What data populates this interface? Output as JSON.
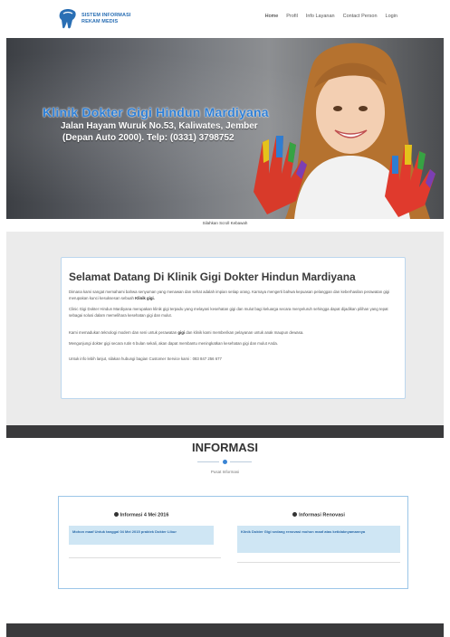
{
  "header": {
    "logo_line1": "SISTEM INFORMASI",
    "logo_line2": "REKAM MEDIS",
    "nav": [
      {
        "label": "Home"
      },
      {
        "label": "Profil"
      },
      {
        "label": "Info Layanan"
      },
      {
        "label": "Contact Person"
      },
      {
        "label": "Login"
      }
    ]
  },
  "hero": {
    "title": "Klinik Dokter Gigi Hindun Mardiyana",
    "address_line1": "Jalan Hayam Wuruk No.53, Kaliwates, Jember",
    "address_line2": "(Depan Auto 2000). Telp: (0331) 3798752",
    "scroll_hint": "Silahkan Scroll Kebawah"
  },
  "welcome": {
    "heading": "Selamat Datang Di Klinik Gigi Dokter Hindun Mardiyana",
    "p1": "Dimana kami sangat memahami bahwa senyuman yang menawan dan sehat adalah impian setiap orang. Karnaya mengerti bahwa kepuasan pelanggan dan keberhasilan perawatan gigi merupakan kunci kesuksesan sebuah",
    "p1_bold": "Klinik gigi.",
    "p2": "Clinic Gigi Dokter Hindun Mardiyana merupakan klinik gigi terpadu yang melayani kesehatan gigi dan mulut bagi keluarga secara menyeluruh sehingga dapat dijadikan pilihan yang tepat sebagai solusi dalam memelihara kesehatan gigi dan mulut.",
    "p3_start": "Kami memadukan teknologi modern dan seni untuk perawatan",
    "p3_bold": "gigi",
    "p3_end": "dan klinik kami memberikan pelayanan untuk anak maupun dewasa.",
    "p4": "Mengunjungi dokter gigi secara rutin 6 bulan sekali, akan dapat membantu meningkatkan kesehatan gigi dan mulut Anda.",
    "p5": "Untuk info lebih lanjut, silakan hubungi bagian Customer Service kami : 083 847 256 677"
  },
  "informasi": {
    "title": "INFORMASI",
    "subtitle": "Pusat Informasi",
    "left_heading": "Informasi 4 Mei 2016",
    "left_note": "Mohon maaf Untuk tanggal 04 Mei 2015 praktek Dokter Libur",
    "right_heading": "Informasi Renovasi",
    "right_note": "Klinik Dokter Gigi sedang renovasi mohon maaf atas ketidaknyamannya"
  },
  "colors": {
    "brand_blue": "#2e7fd6",
    "note_bg": "#cfe6f4",
    "dark_band": "#3a3a3c"
  }
}
